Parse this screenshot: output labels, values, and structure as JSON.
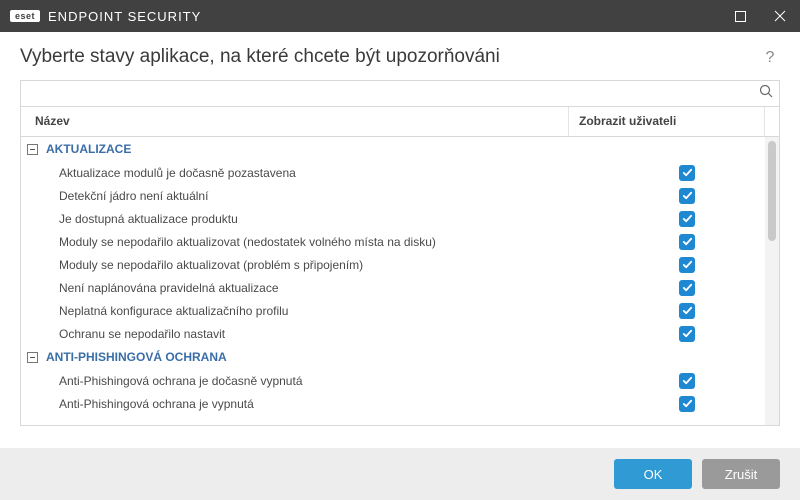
{
  "titlebar": {
    "brand_short": "eset",
    "brand_text": "ENDPOINT SECURITY"
  },
  "header": {
    "title": "Vyberte stavy aplikace, na které chcete být upozorňováni"
  },
  "columns": {
    "name": "Název",
    "show_user": "Zobrazit uživateli"
  },
  "groups": [
    {
      "title": "AKTUALIZACE",
      "items": [
        {
          "label": "Aktualizace modulů je dočasně pozastavena",
          "checked": true
        },
        {
          "label": "Detekční jádro není aktuální",
          "checked": true
        },
        {
          "label": "Je dostupná aktualizace produktu",
          "checked": true
        },
        {
          "label": "Moduly se nepodařilo aktualizovat (nedostatek volného místa na disku)",
          "checked": true
        },
        {
          "label": "Moduly se nepodařilo aktualizovat (problém s připojením)",
          "checked": true
        },
        {
          "label": "Není naplánována pravidelná aktualizace",
          "checked": true
        },
        {
          "label": "Neplatná konfigurace aktualizačního profilu",
          "checked": true
        },
        {
          "label": "Ochranu se nepodařilo nastavit",
          "checked": true
        }
      ]
    },
    {
      "title": "ANTI-PHISHINGOVÁ OCHRANA",
      "items": [
        {
          "label": "Anti-Phishingová ochrana je dočasně vypnutá",
          "checked": true
        },
        {
          "label": "Anti-Phishingová ochrana je vypnutá",
          "checked": true
        }
      ]
    }
  ],
  "footer": {
    "ok": "OK",
    "cancel": "Zrušit"
  }
}
